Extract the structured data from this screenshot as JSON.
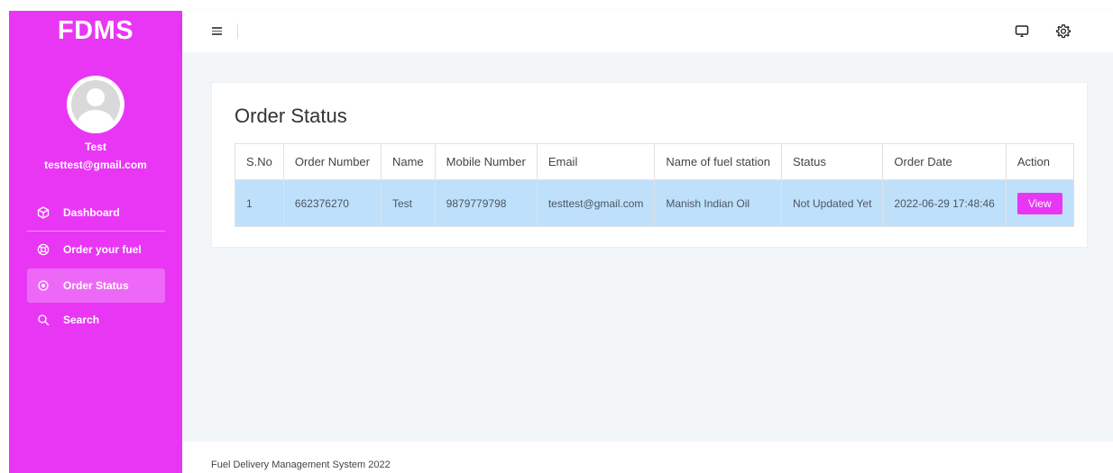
{
  "sidebar": {
    "brand": "FDMS",
    "user_name": "Test",
    "user_email": "testtest@gmail.com",
    "items": [
      {
        "label": "Dashboard",
        "icon": "box-icon"
      },
      {
        "label": "Order your fuel",
        "icon": "lifebuoy-icon"
      },
      {
        "label": "Order Status",
        "icon": "target-icon",
        "active": true
      },
      {
        "label": "Search",
        "icon": "search-icon"
      }
    ]
  },
  "header": {
    "menu_icon": "hamburger-icon",
    "right_icons": [
      "monitor-icon",
      "gear-icon"
    ]
  },
  "main": {
    "title": "Order Status",
    "table": {
      "columns": [
        "S.No",
        "Order Number",
        "Name",
        "Mobile Number",
        "Email",
        "Name of fuel station",
        "Status",
        "Order Date",
        "Action"
      ],
      "rows": [
        {
          "sno": "1",
          "order_number": "662376270",
          "name": "Test",
          "mobile": "9879779798",
          "email": "testtest@gmail.com",
          "station": "Manish Indian Oil",
          "status": "Not Updated Yet",
          "date": "2022-06-29 17:48:46",
          "action": "View"
        }
      ]
    }
  },
  "footer": {
    "text": "Fuel Delivery Management System 2022"
  },
  "colors": {
    "accent": "#e936f5",
    "row_highlight": "#bee0fb",
    "content_bg": "#f3f6f9"
  }
}
